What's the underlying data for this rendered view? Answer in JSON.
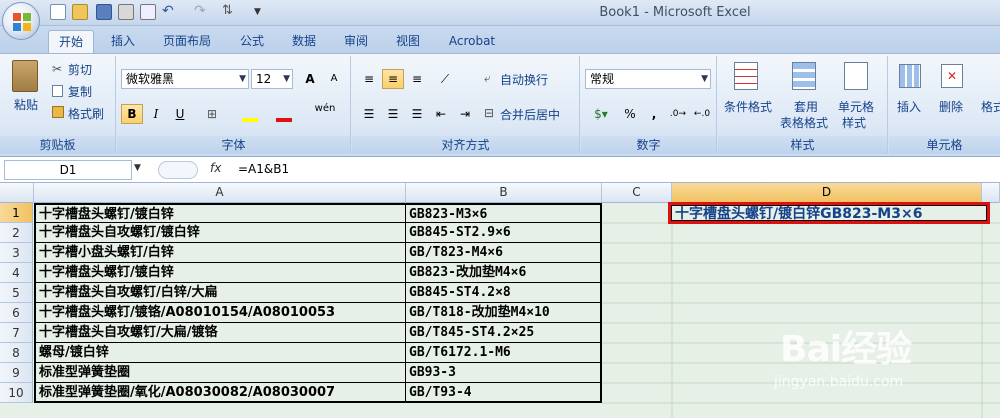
{
  "window": {
    "title": "Book1 - Microsoft Excel"
  },
  "ribbon_tabs": [
    "开始",
    "插入",
    "页面布局",
    "公式",
    "数据",
    "审阅",
    "视图",
    "Acrobat"
  ],
  "clipboard": {
    "paste": "粘贴",
    "cut": "剪切",
    "copy": "复制",
    "format_painter": "格式刷",
    "label": "剪贴板"
  },
  "font": {
    "name": "微软雅黑",
    "size": "12",
    "grow": "A",
    "shrink": "A",
    "bold": "B",
    "italic": "I",
    "underline": "U",
    "label": "字体",
    "wen": "wén"
  },
  "alignment": {
    "wrap": "自动换行",
    "merge": "合并后居中",
    "label": "对齐方式"
  },
  "number": {
    "format": "常规",
    "percent": "%",
    "comma": ",",
    "label": "数字"
  },
  "styles": {
    "conditional": "条件格式",
    "table_format_1": "套用",
    "table_format_2": "表格格式",
    "cell_style_1": "单元格",
    "cell_style_2": "样式",
    "label": "样式"
  },
  "cells_group": {
    "insert": "插入",
    "delete": "删除",
    "format": "格式",
    "label": "单元格"
  },
  "formula_bar": {
    "name_box": "D1",
    "fx": "fx",
    "formula": "=A1&B1"
  },
  "columns": [
    "A",
    "B",
    "C",
    "D"
  ],
  "rows": [
    {
      "n": "1",
      "a": "十字槽盘头螺钉/镀白锌",
      "b": "GB823-M3×6"
    },
    {
      "n": "2",
      "a": "十字槽盘头自攻螺钉/镀白锌",
      "b": "GB845-ST2.9×6"
    },
    {
      "n": "3",
      "a": "十字槽小盘头螺钉/白锌",
      "b": "GB/T823-M4×6"
    },
    {
      "n": "4",
      "a": "十字槽盘头螺钉/镀白锌",
      "b": "GB823-改加垫M4×6"
    },
    {
      "n": "5",
      "a": "十字槽盘头自攻螺钉/白锌/大扁",
      "b": "GB845-ST4.2×8"
    },
    {
      "n": "6",
      "a": "十字槽盘头螺钉/镀铬/A08010154/A08010053",
      "b": "GB/T818-改加垫M4×10"
    },
    {
      "n": "7",
      "a": "十字槽盘头自攻螺钉/大扁/镀铬",
      "b": "GB/T845-ST4.2×25"
    },
    {
      "n": "8",
      "a": "螺母/镀白锌",
      "b": "GB/T6172.1-M6"
    },
    {
      "n": "9",
      "a": "标准型弹簧垫圈",
      "b": "GB93-3"
    },
    {
      "n": "10",
      "a": "标准型弹簧垫圈/氧化/A08030082/A08030007",
      "b": "GB/T93-4"
    }
  ],
  "d1_value": "十字槽盘头螺钉/镀白锌GB823-M3×6",
  "watermark": {
    "brand": "Bai经验",
    "url": "jingyan.baidu.com"
  }
}
